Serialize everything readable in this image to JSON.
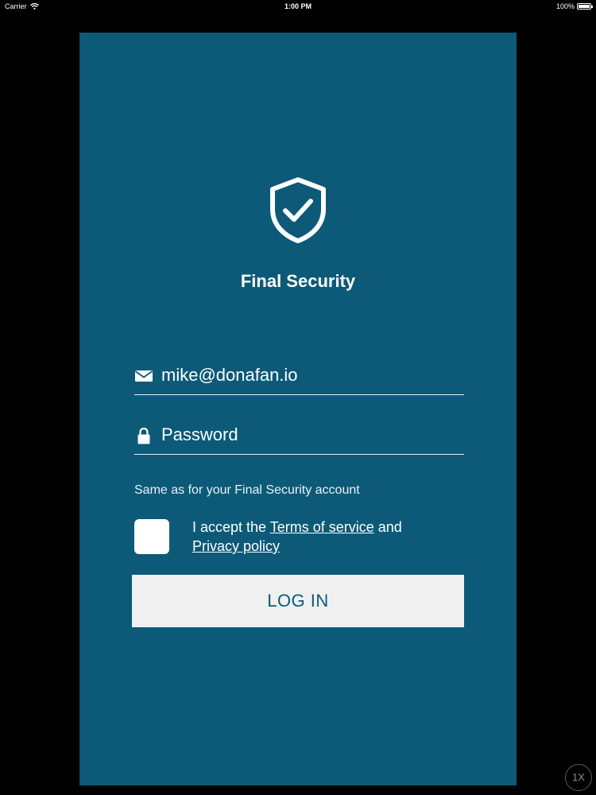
{
  "status_bar": {
    "carrier": "Carrier",
    "time": "1:00 PM",
    "battery": "100%",
    "battery_level": 1.0
  },
  "app": {
    "title": "Final Security",
    "logo_icon": "shield-check-icon"
  },
  "form": {
    "email": {
      "icon": "envelope-icon",
      "value": "mike@donafan.io",
      "placeholder": ""
    },
    "password": {
      "icon": "lock-icon",
      "value": "",
      "placeholder": "Password"
    },
    "hint": "Same as for your Final Security account",
    "terms": {
      "prefix": "I accept the ",
      "terms_link": "Terms of service",
      "middle": " and",
      "privacy_link": "Privacy policy",
      "checked": false
    },
    "login_label": "LOG IN"
  },
  "scale_badge": "1X",
  "colors": {
    "panel": "#0c5a78",
    "button_bg": "#f0f0f0",
    "button_text": "#0c5a78"
  }
}
